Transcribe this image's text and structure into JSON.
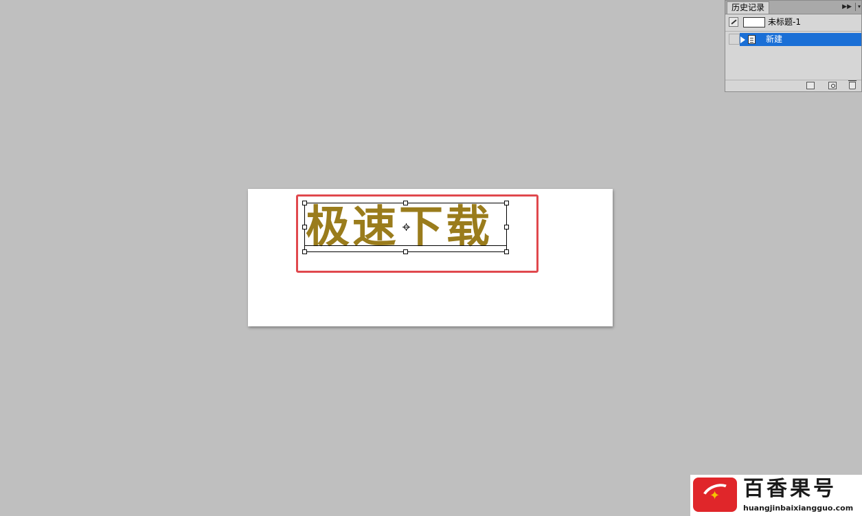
{
  "canvas": {
    "text_layer": "极速下载",
    "text_color": "#9a7c1c",
    "highlight_color": "#e0484d"
  },
  "history_panel": {
    "tab_label": "历史记录",
    "menu_icon": "double-arrow-icon",
    "snapshot": {
      "label": "未标题-1",
      "icon": "history-brush-icon"
    },
    "states": [
      {
        "label": "新建",
        "selected": true,
        "icon": "document-icon"
      }
    ],
    "footer_buttons": [
      "new-document-from-state-icon",
      "camera-snapshot-icon",
      "trash-icon"
    ],
    "selection_color": "#1a6fd6"
  },
  "watermark": {
    "title": "百香果号",
    "url": "huangjinbaixiangguo.com",
    "brand_color": "#e0262a"
  }
}
